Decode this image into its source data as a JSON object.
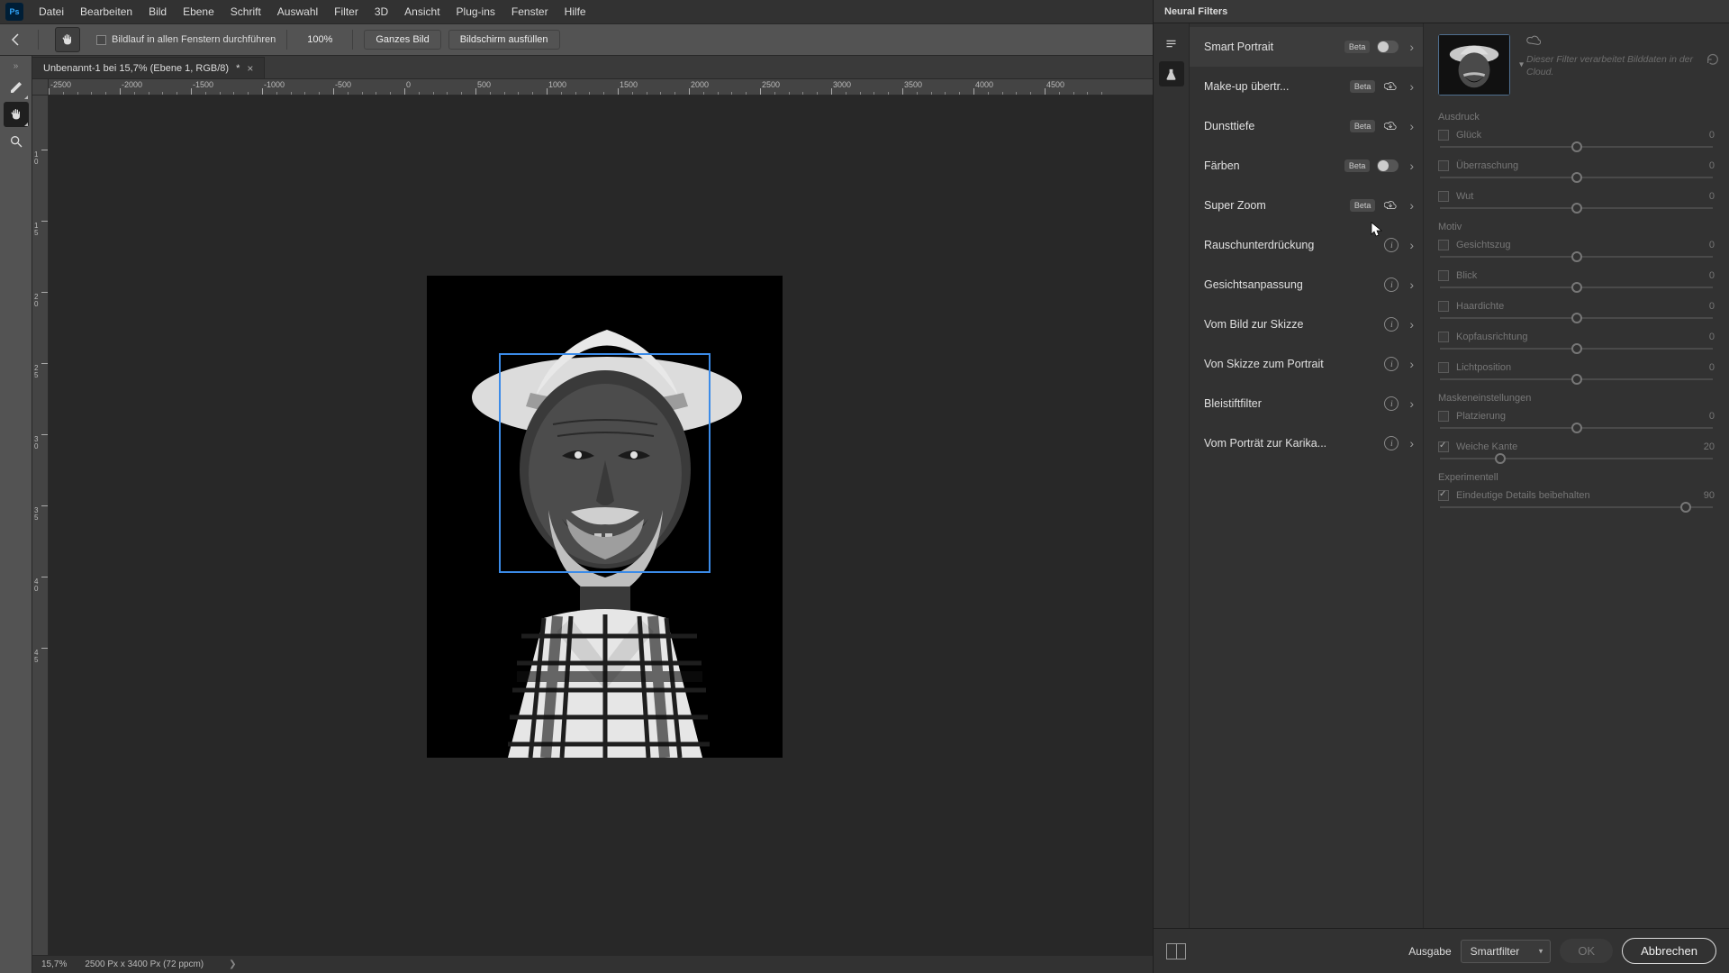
{
  "menu": {
    "items": [
      "Datei",
      "Bearbeiten",
      "Bild",
      "Ebene",
      "Schrift",
      "Auswahl",
      "Filter",
      "3D",
      "Ansicht",
      "Plug-ins",
      "Fenster",
      "Hilfe"
    ]
  },
  "optbar": {
    "scroll_all_label": "Bildlauf in allen Fenstern durchführen",
    "zoom": "100%",
    "btn_full": "Ganzes Bild",
    "btn_screen": "Bildschirm ausfüllen"
  },
  "doc": {
    "tab_title": "Unbenannt-1 bei 15,7% (Ebene 1, RGB/8)",
    "tab_mark": "*"
  },
  "ruler_h": [
    "-2500",
    "-2000",
    "-1500",
    "-1000",
    "-500",
    "0",
    "500",
    "1000",
    "1500",
    "2000",
    "2500",
    "3000",
    "3500",
    "4000",
    "4500"
  ],
  "ruler_v_pairs": [
    [
      "1",
      "0"
    ],
    [
      "1",
      "5"
    ],
    [
      "2",
      "0"
    ],
    [
      "2",
      "5"
    ],
    [
      "3",
      "0"
    ],
    [
      "3",
      "5"
    ],
    [
      "4",
      "0"
    ],
    [
      "4",
      "5"
    ]
  ],
  "status": {
    "zoom": "15,7%",
    "info": "2500 Px x 3400 Px (72 ppcm)"
  },
  "neural": {
    "title": "Neural Filters",
    "filters": [
      {
        "name": "Smart Portrait",
        "beta": true,
        "action": "toggle",
        "selected": true
      },
      {
        "name": "Make-up übertr...",
        "beta": true,
        "action": "download"
      },
      {
        "name": "Dunsttiefe",
        "beta": true,
        "action": "download"
      },
      {
        "name": "Färben",
        "beta": true,
        "action": "toggle"
      },
      {
        "name": "Super Zoom",
        "beta": true,
        "action": "download"
      },
      {
        "name": "Rauschunterdrückung",
        "beta": false,
        "action": "info"
      },
      {
        "name": "Gesichtsanpassung",
        "beta": false,
        "action": "info"
      },
      {
        "name": "Vom Bild zur Skizze",
        "beta": false,
        "action": "info"
      },
      {
        "name": "Von Skizze zum Portrait",
        "beta": false,
        "action": "info"
      },
      {
        "name": "Bleistiftfilter",
        "beta": false,
        "action": "info"
      },
      {
        "name": "Vom Porträt zur Karika...",
        "beta": false,
        "action": "info"
      }
    ],
    "cloud_note": "Dieser Filter verarbeitet Bilddaten in der Cloud.",
    "section_ausdruck": "Ausdruck",
    "sliders_ausdruck": [
      {
        "label": "Glück",
        "value": "0",
        "pos": 50
      },
      {
        "label": "Überraschung",
        "value": "0",
        "pos": 50
      },
      {
        "label": "Wut",
        "value": "0",
        "pos": 50
      }
    ],
    "section_motiv": "Motiv",
    "sliders_motiv": [
      {
        "label": "Gesichtszug",
        "value": "0",
        "pos": 50
      },
      {
        "label": "Blick",
        "value": "0",
        "pos": 50
      },
      {
        "label": "Haardichte",
        "value": "0",
        "pos": 50
      },
      {
        "label": "Kopfausrichtung",
        "value": "0",
        "pos": 50
      },
      {
        "label": "Lichtposition",
        "value": "0",
        "pos": 50
      }
    ],
    "section_maske": "Maskeneinstellungen",
    "sliders_maske": [
      {
        "label": "Platzierung",
        "value": "0",
        "pos": 50,
        "checked": false
      },
      {
        "label": "Weiche Kante",
        "value": "20",
        "pos": 22,
        "checked": true
      }
    ],
    "section_exp": "Experimentell",
    "sliders_exp": [
      {
        "label": "Eindeutige Details beibehalten",
        "value": "90",
        "pos": 90,
        "checked": true
      }
    ],
    "footer": {
      "output_label": "Ausgabe",
      "output_value": "Smartfilter",
      "ok": "OK",
      "cancel": "Abbrechen"
    }
  }
}
